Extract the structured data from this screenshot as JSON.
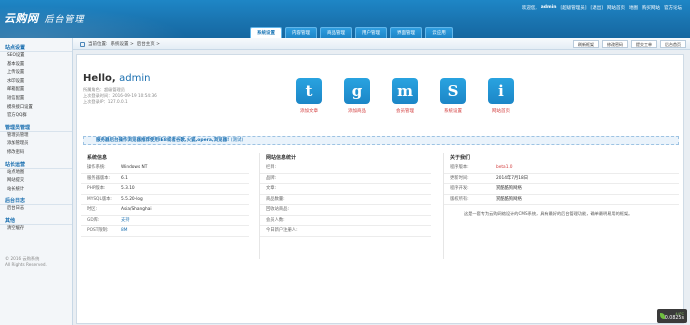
{
  "header": {
    "brand": "云购网",
    "subtitle": "后台管理",
    "topbar": [
      "欢迎您,",
      "admin",
      "[超级管理员]",
      "[退出]",
      "网站首页",
      "地图",
      "购买网站",
      "官方论坛"
    ]
  },
  "nav": {
    "tabs": [
      "系统设置",
      "内容管理",
      "商品管理",
      "用户管理",
      "界面管理",
      "云应用"
    ],
    "active": 0
  },
  "breadcrumb": {
    "items": [
      "当前位置:",
      "系统设置 >",
      "后台主页 >"
    ],
    "buttons": [
      "刷新框架",
      "修改密码",
      "提交工单",
      "后台首页"
    ]
  },
  "sidebar": {
    "groups": [
      {
        "title": "站点设置",
        "items": [
          "SEO设置",
          "基本设置",
          "上传设置",
          "水印设置",
          "邮箱配置",
          "短信配置",
          "模块接口设置",
          "官方QQ群"
        ]
      },
      {
        "title": "管理员管理",
        "items": [
          "管理员管理",
          "添加管理员",
          "修改密码"
        ]
      },
      {
        "title": "站长运营",
        "items": [
          "站点地图",
          "网站提交",
          "站长统计"
        ]
      },
      {
        "title": "后台日志",
        "items": [
          "后台日志"
        ]
      },
      {
        "title": "其他",
        "items": [
          "清空缓存"
        ]
      }
    ],
    "footer": [
      "© 2016 云购系统",
      "All Rights Reserved."
    ]
  },
  "welcome": {
    "hello": "Hello,",
    "user": "admin",
    "meta": [
      "所属角色：超级管理员",
      "上次登录时间：2016-09-19 10:54:36",
      "上次登录IP：127.0.0.1"
    ]
  },
  "shortcuts": [
    {
      "glyph": "t",
      "label": "添加文章"
    },
    {
      "glyph": "g",
      "label": "添加商品"
    },
    {
      "glyph": "m",
      "label": "会员管理"
    },
    {
      "glyph": "S",
      "label": "系统设置"
    },
    {
      "glyph": "i",
      "label": "网站首页"
    }
  ],
  "notice": {
    "text": "服务器后台操作浏览器推荐使用IE8或者谷歌,火狐,opera,浏览器!",
    "tail": "(测试)"
  },
  "system_info": {
    "title": "系统信息",
    "rows": [
      {
        "k": "操作系统:",
        "v": "Windows NT"
      },
      {
        "k": "服务器版本:",
        "v": "6.1"
      },
      {
        "k": "PHP版本:",
        "v": "5.3.10"
      },
      {
        "k": "MYSQL版本:",
        "v": "5.5.20-log"
      },
      {
        "k": "时区:",
        "v": "Asia/Shanghai"
      },
      {
        "k": "GD库:",
        "v": "支持"
      },
      {
        "k": "POST限制:",
        "v": "8M"
      }
    ]
  },
  "site_stats": {
    "title": "网站信息统计",
    "rows": [
      {
        "k": "栏目:",
        "v": ""
      },
      {
        "k": "品牌:",
        "v": ""
      },
      {
        "k": "文章:",
        "v": ""
      },
      {
        "k": "商品数量:",
        "v": ""
      },
      {
        "k": "回收站商品:",
        "v": ""
      },
      {
        "k": "会员人数:",
        "v": ""
      },
      {
        "k": "今日新户注册人:",
        "v": ""
      }
    ]
  },
  "about": {
    "title": "关于我们",
    "rows": [
      {
        "k": "程序版本:",
        "v": "beta1.0"
      },
      {
        "k": "更新时间:",
        "v": "2014年7月18日"
      },
      {
        "k": "程序开发:",
        "v": "赏酷酷狗网络"
      },
      {
        "k": "版权所有:",
        "v": "赏酷酷狗网络"
      }
    ],
    "desc": "这是一套专为云购网络设计的CMS系统，具有最好的后台管理功能，确单最明易用的框架。"
  },
  "speed": {
    "top": "44°C",
    "value": "0.0825s"
  }
}
